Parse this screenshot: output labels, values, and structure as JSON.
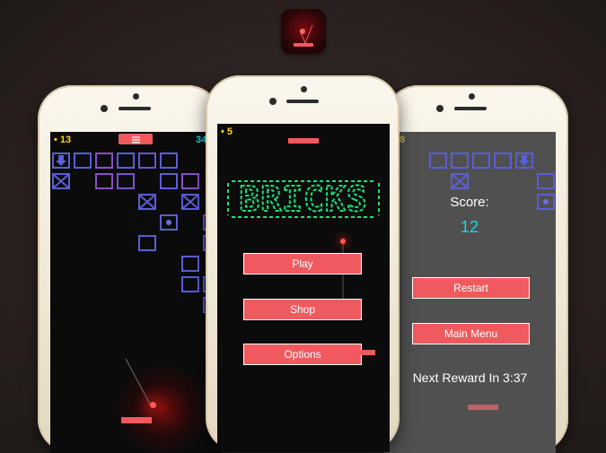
{
  "left_screen": {
    "coins": "13",
    "score": "34",
    "menu_icon": "hamburger-menu-icon"
  },
  "center_screen": {
    "coins": "5",
    "title": "BRICKS",
    "buttons": {
      "play": "Play",
      "shop": "Shop",
      "options": "Options"
    }
  },
  "right_screen": {
    "coins": "8",
    "score_label": "Score:",
    "score_value": "12",
    "buttons": {
      "restart": "Restart",
      "main_menu": "Main Menu"
    },
    "reward_text": "Next Reward In 3:37"
  },
  "colors": {
    "accent": "#f05a5e",
    "gold": "#ffd21a",
    "cyan": "#19d9e6",
    "brick_blue": "#5a5ed6",
    "brick_purple": "#8a4fc8",
    "title_green": "#19e07a",
    "gameover_bg": "#505050"
  }
}
